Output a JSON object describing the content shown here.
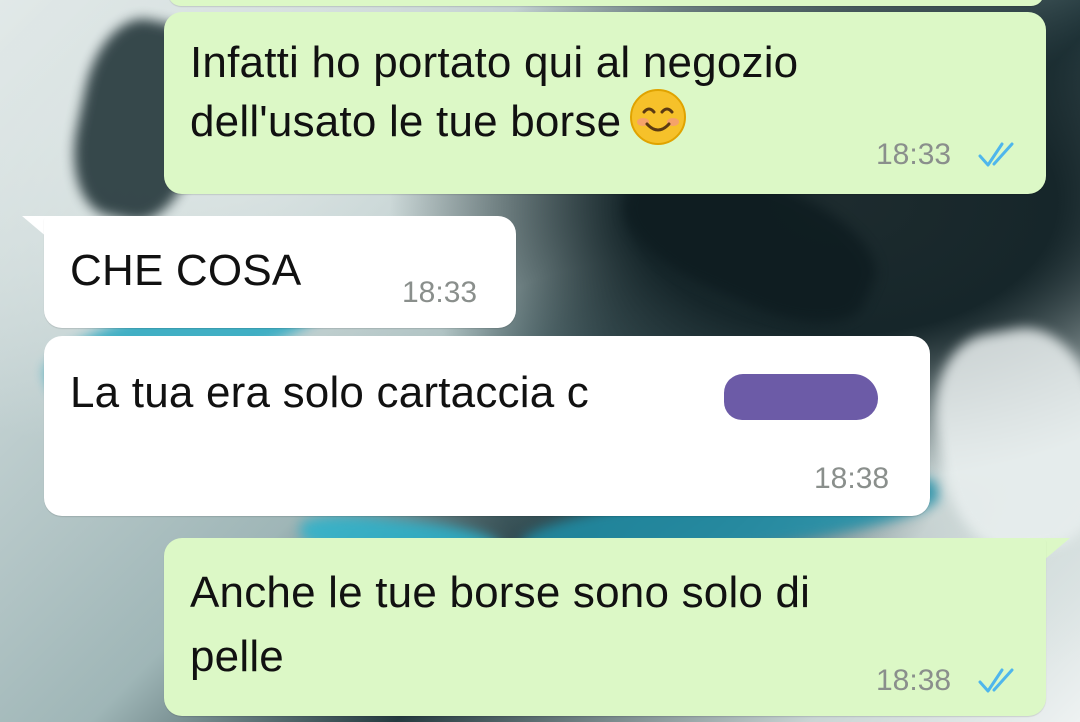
{
  "messages": [
    {
      "direction": "outgoing",
      "lines": [
        "Infatti ho portato qui al negozio",
        "dell'usato le tue borse"
      ],
      "emoji": "smiling-face-emoji",
      "time": "18:33",
      "status": "read"
    },
    {
      "direction": "incoming",
      "lines": [
        "CHE COSA"
      ],
      "time": "18:33"
    },
    {
      "direction": "incoming",
      "lines": [
        "La tua era solo cartaccia c"
      ],
      "redacted": true,
      "time": "18:38"
    },
    {
      "direction": "outgoing",
      "lines": [
        "Anche le tue borse sono solo di",
        "pelle"
      ],
      "time": "18:38",
      "status": "read"
    }
  ],
  "colors": {
    "outgoing_bubble": "#dcf8c6",
    "incoming_bubble": "#ffffff",
    "read_ticks": "#4fb6ec",
    "timestamp": "#8a8f8c",
    "redaction": "#6c5ba7"
  }
}
